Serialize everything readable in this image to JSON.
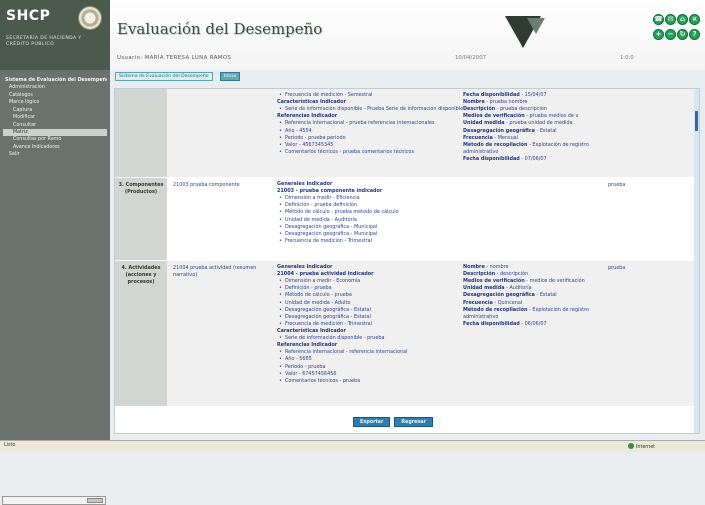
{
  "header": {
    "logo": "SHCP",
    "secretaria": "SECRETARÍA DE HACIENDA Y CRÉDITO PÚBLICO",
    "title": "Evaluación del Desempeño",
    "user_label": "Usuario: MARÍA TERESA LUNA RAMOS",
    "date": "10/04/2007",
    "version": "1.0.0",
    "colors": {
      "brand_bg": "#4b5a4d",
      "accent_green": "#23a25a",
      "link_blue": "#2b3f8f"
    },
    "icons": [
      "phone-icon",
      "mail-icon",
      "home-icon",
      "close-icon",
      "add-icon",
      "minus-icon",
      "refresh-icon",
      "help-icon"
    ]
  },
  "sidebar": {
    "items": [
      {
        "label": "Sistema de Evaluación del Desempeño",
        "level": 0
      },
      {
        "label": "Administración",
        "level": 1
      },
      {
        "label": "Catálogos",
        "level": 1
      },
      {
        "label": "Marco lógico",
        "level": 1
      },
      {
        "label": "Captura",
        "level": 2
      },
      {
        "label": "Modificar",
        "level": 2
      },
      {
        "label": "Consultar",
        "level": 2
      },
      {
        "label": "Matriz",
        "level": 2,
        "selected": true
      },
      {
        "label": "Consultas por Ramo",
        "level": 2
      },
      {
        "label": "Avance Indicadores",
        "level": 2
      },
      {
        "label": "Salir",
        "level": 1
      }
    ]
  },
  "breadcrumb": {
    "label": "Sistema de Evaluación del Desempeño",
    "button": "Inicio"
  },
  "matrix": {
    "row1": {
      "indicator_lines": [
        {
          "t": "Frecuencia de medición - Semestral",
          "s": "b"
        },
        {
          "t": "Características Indicador",
          "s": "h"
        },
        {
          "t": "Serie de información disponible - Prueba Serie de información disponible",
          "s": "b"
        },
        {
          "t": "Referencias Indicador",
          "s": "h"
        },
        {
          "t": "Referencia internacional - prueba referencias internacionales",
          "s": "b"
        },
        {
          "t": "Año - 4554",
          "s": "b"
        },
        {
          "t": "Periodo - prueba periodo",
          "s": "b"
        },
        {
          "t": "Valor - 4567345345",
          "s": "b"
        },
        {
          "t": "Comentarios técnicos - prueba comentarios técnicos",
          "s": "b"
        }
      ],
      "means": [
        {
          "k": "Fecha disponibilidad",
          "v": "15/04/07"
        },
        {
          "k": "Nombre",
          "v": "prueba nombre"
        },
        {
          "k": "Descripción",
          "v": "prueba descripción"
        },
        {
          "k": "Medios de verificación",
          "v": "prueba medios de v"
        },
        {
          "k": "Unidad medida",
          "v": "prueba unidad de medida"
        },
        {
          "k": "Desagregación geográfica",
          "v": "Estatal"
        },
        {
          "k": "Frecuencia",
          "v": "Mensual"
        },
        {
          "k": "Método de recopilación",
          "v": "Explotación de registro administrativo"
        },
        {
          "k": "Fecha disponibilidad",
          "v": "07/06/07"
        }
      ]
    },
    "row2": {
      "name": "3. Componentes (Productos)",
      "summary": "21003 prueba componente",
      "indicator_lines": [
        {
          "t": "Generales Indicador",
          "s": "h"
        },
        {
          "t": "21003 - prueba componente indicador",
          "s": "k"
        },
        {
          "t": "Dimensión a medir - Eficiencia",
          "s": "b"
        },
        {
          "t": "Definición - prueba definición",
          "s": "b"
        },
        {
          "t": "Método de cálculo - prueba método de cálculo",
          "s": "b"
        },
        {
          "t": "Unidad de medida - Auditoría",
          "s": "b"
        },
        {
          "t": "Desagregación geográfica - Municipal",
          "s": "b"
        },
        {
          "t": "Desagregación geográfica - Municipal",
          "s": "b"
        },
        {
          "t": "Frecuencia de medición - Trimestral",
          "s": "b"
        }
      ],
      "assumptions": "prueba"
    },
    "row3": {
      "name": "4. Actividades (acciones y procesos)",
      "summary": "21004 prueba actividad (resumen narrativo)",
      "indicator_lines": [
        {
          "t": "Generales Indicador",
          "s": "h"
        },
        {
          "t": "21004 - prueba actividad indicador",
          "s": "k"
        },
        {
          "t": "Dimensión a medir - Economía",
          "s": "b"
        },
        {
          "t": "Definición - prueba",
          "s": "b"
        },
        {
          "t": "Método de cálculo - prueba",
          "s": "b"
        },
        {
          "t": "Unidad de medida - Adulto",
          "s": "b"
        },
        {
          "t": "Desagregación geográfica - Estatal",
          "s": "b"
        },
        {
          "t": "Desagregación geográfica - Estatal",
          "s": "b"
        },
        {
          "t": "Frecuencia de medición - Trimestral",
          "s": "b"
        },
        {
          "t": "Características Indicador",
          "s": "h"
        },
        {
          "t": "Serie de información disponible - prueba",
          "s": "b"
        },
        {
          "t": "Referencias Indicador",
          "s": "h"
        },
        {
          "t": "Referencia internacional - referencia internacional",
          "s": "b"
        },
        {
          "t": "Año - 5665",
          "s": "b"
        },
        {
          "t": "Periodo - prueba",
          "s": "b"
        },
        {
          "t": "Valor - 67457456456",
          "s": "b"
        },
        {
          "t": "Comentarios técnicos - prueba",
          "s": "b"
        }
      ],
      "means": [
        {
          "k": "Nombre",
          "v": "nombre"
        },
        {
          "k": "Descripción",
          "v": "descripción"
        },
        {
          "k": "Medios de verificación",
          "v": "medios de verificación"
        },
        {
          "k": "Unidad medida",
          "v": "Auditoría"
        },
        {
          "k": "Desagregación geográfica",
          "v": "Estatal"
        },
        {
          "k": "Frecuencia",
          "v": "Quincenal"
        },
        {
          "k": "Método de recopilación",
          "v": "Explotación de registro administrativo"
        },
        {
          "k": "Fecha disponibilidad",
          "v": "06/06/07"
        }
      ],
      "assumptions": "prueba"
    }
  },
  "actions": {
    "export_label": "Exportar",
    "back_label": "Regresar"
  },
  "status": {
    "left": "Listo",
    "right": "Internet"
  }
}
